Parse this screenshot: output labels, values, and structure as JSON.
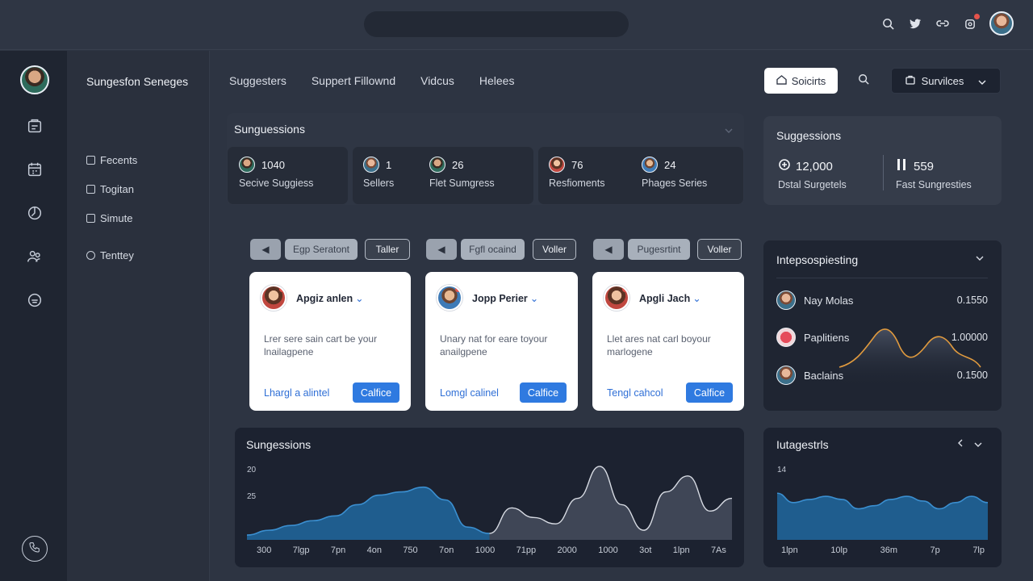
{
  "topbar": {
    "icons": [
      "search-icon",
      "twitter-icon",
      "link-icon",
      "notification-icon"
    ]
  },
  "rail": {
    "icons": [
      "document-icon",
      "calendar-icon",
      "clock-icon",
      "people-icon",
      "chat-icon",
      "phone-icon"
    ]
  },
  "sidebar": {
    "title": "Sungesfon Seneges",
    "items": [
      {
        "label": "Fecents",
        "icon": "file-icon"
      },
      {
        "label": "Togitan",
        "icon": "list-icon"
      },
      {
        "label": "Simute",
        "icon": "window-icon"
      },
      {
        "label": "Tenttey",
        "icon": "user-icon"
      }
    ]
  },
  "nav": {
    "tabs": [
      "Suggesters",
      "Suppert Fillownd",
      "Vidcus",
      "Helees"
    ]
  },
  "actions": {
    "white_button": "Soicirts",
    "dark_button": "Survilces"
  },
  "suggestions": {
    "title": "Sunguessions",
    "stats": [
      {
        "value": "1040",
        "label": "Secive Suggiess"
      },
      {
        "value": "1",
        "label": "Sellers"
      },
      {
        "value": "26",
        "label": "Flet Sumgress"
      },
      {
        "value": "76",
        "label": "Resfioments"
      },
      {
        "value": "24",
        "label": "Phages Series"
      }
    ]
  },
  "right_stats": {
    "title": "Suggessions",
    "stats": [
      {
        "value": "12,000",
        "label": "Dstal Surgetels"
      },
      {
        "value": "559",
        "label": "Fast Sungresties"
      }
    ]
  },
  "filter_groups": [
    {
      "filled": "Egp Seratont",
      "outline": "Taller"
    },
    {
      "filled": "Fgfl ocaind",
      "outline": "Voller"
    },
    {
      "filled": "Pugesrtint",
      "outline": "Voller"
    }
  ],
  "cards": [
    {
      "name": "Apgiz anlen",
      "desc": "Lrer sere sain cart be your lnailagpene",
      "link": "Lhargl a alintel",
      "cta": "Calfice"
    },
    {
      "name": "Jopp Perier",
      "desc": "Unary nat for eare toyour anailgpene",
      "link": "Lomgl calinel",
      "cta": "Calfice"
    },
    {
      "name": "Apgli Jach",
      "desc": "Llet ares nat carl boyour marlogene",
      "link": "Tengl cahcol",
      "cta": "Calfice"
    }
  ],
  "list_panel": {
    "title": "Intepsospiesting",
    "rows": [
      {
        "name": "Nay Molas",
        "value": "0.1550"
      },
      {
        "name": "Paplitiens",
        "value": "1.00000"
      },
      {
        "name": "Baclains",
        "value": "0.1500"
      }
    ]
  },
  "chart_data": [
    {
      "type": "area",
      "title": "Sungessions",
      "y_ticks": [
        "20",
        "25"
      ],
      "x_labels": [
        "300",
        "7lgp",
        "7pn",
        "4on",
        "750",
        "7on",
        "1000",
        "71pp",
        "2000",
        "1000",
        "3ot",
        "1lpn",
        "7As"
      ],
      "series": [
        {
          "values": [
            3,
            6,
            9,
            12,
            15,
            22,
            28,
            30,
            33,
            25,
            8,
            4,
            20,
            14,
            10,
            26,
            46,
            22,
            6,
            30,
            40,
            18,
            26
          ]
        }
      ]
    },
    {
      "type": "area",
      "title": "Iutagestrls",
      "y_ticks": [
        "14"
      ],
      "x_labels": [
        "1lpn",
        "10lp",
        "36m",
        "7p",
        "7lp"
      ],
      "series": [
        {
          "values": [
            30,
            24,
            26,
            28,
            26,
            20,
            22,
            26,
            28,
            25,
            20,
            24,
            28,
            24
          ]
        }
      ]
    }
  ]
}
